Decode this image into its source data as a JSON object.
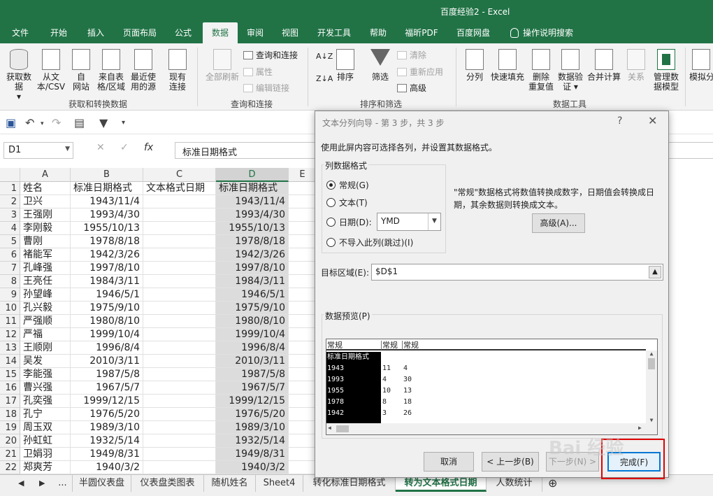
{
  "window": {
    "title": "百度经验2  -  Excel"
  },
  "menu": {
    "tabs": [
      "文件",
      "开始",
      "插入",
      "页面布局",
      "公式",
      "数据",
      "审阅",
      "视图",
      "开发工具",
      "帮助",
      "福昕PDF",
      "百度网盘",
      "操作说明搜索"
    ],
    "active": "数据"
  },
  "ribbon": {
    "get_data": "获取数据",
    "from_text_l1": "从文",
    "from_text_l2": "本/CSV",
    "from_web_l1": "自",
    "from_web_l2": "网站",
    "from_table_l1": "来自表",
    "from_table_l2": "格/区域",
    "recent_l1": "最近使",
    "recent_l2": "用的源",
    "existing_l1": "现有",
    "existing_l2": "连接",
    "group1": "获取和转换数据",
    "refresh_all": "全部刷新",
    "queries": "查询和连接",
    "properties": "属性",
    "edit_links": "编辑链接",
    "group2": "查询和连接",
    "sort": "排序",
    "filter": "筛选",
    "clear": "清除",
    "reapply": "重新应用",
    "advanced": "高级",
    "group3": "排序和筛选",
    "split": "分列",
    "flash_fill": "快速填充",
    "remove_dup_l1": "删除",
    "remove_dup_l2": "重复值",
    "validate_l1": "数据验",
    "validate_l2": "证",
    "consolidate": "合并计算",
    "relations": "关系",
    "model_l1": "管理数",
    "model_l2": "据模型",
    "group4": "数据工具",
    "whatif": "模拟分"
  },
  "formula_bar": {
    "name_box": "D1",
    "fx": "fx",
    "value": "标准日期格式"
  },
  "columns": [
    "A",
    "B",
    "C",
    "D",
    "E"
  ],
  "rows": [
    [
      "姓名",
      "标准日期格式",
      "文本格式日期",
      "标准日期格式"
    ],
    [
      "卫兴",
      "1943/11/4",
      "",
      "1943/11/4"
    ],
    [
      "王强刚",
      "1993/4/30",
      "",
      "1993/4/30"
    ],
    [
      "李刚毅",
      "1955/10/13",
      "",
      "1955/10/13"
    ],
    [
      "曹刚",
      "1978/8/18",
      "",
      "1978/8/18"
    ],
    [
      "褚能军",
      "1942/3/26",
      "",
      "1942/3/26"
    ],
    [
      "孔峰强",
      "1997/8/10",
      "",
      "1997/8/10"
    ],
    [
      "王亮任",
      "1984/3/11",
      "",
      "1984/3/11"
    ],
    [
      "孙望峰",
      "1946/5/1",
      "",
      "1946/5/1"
    ],
    [
      "孔兴毅",
      "1975/9/10",
      "",
      "1975/9/10"
    ],
    [
      "严强顺",
      "1980/8/10",
      "",
      "1980/8/10"
    ],
    [
      "严福",
      "1999/10/4",
      "",
      "1999/10/4"
    ],
    [
      "王顺刚",
      "1996/8/4",
      "",
      "1996/8/4"
    ],
    [
      "吴发",
      "2010/3/11",
      "",
      "2010/3/11"
    ],
    [
      "李能强",
      "1987/5/8",
      "",
      "1987/5/8"
    ],
    [
      "曹兴强",
      "1967/5/7",
      "",
      "1967/5/7"
    ],
    [
      "孔奕强",
      "1999/12/15",
      "",
      "1999/12/15"
    ],
    [
      "孔宁",
      "1976/5/20",
      "",
      "1976/5/20"
    ],
    [
      "周玉双",
      "1989/3/10",
      "",
      "1989/3/10"
    ],
    [
      "孙虹虹",
      "1932/5/14",
      "",
      "1932/5/14"
    ],
    [
      "卫娟羽",
      "1949/8/31",
      "",
      "1949/8/31"
    ],
    [
      "郑爽芳",
      "1940/3/2",
      "",
      "1940/3/2"
    ]
  ],
  "sheets": [
    "...",
    "半圆仪表盘",
    "仪表盘类图表",
    "随机姓名",
    "Sheet4",
    "转化标准日期格式",
    "转为文本格式日期",
    "人数统计"
  ],
  "active_sheet": "转为文本格式日期",
  "dialog": {
    "title": "文本分列向导 - 第 3 步，共 3 步",
    "help": "?",
    "close": "✕",
    "instruction": "使用此屏内容可选择各列，并设置其数据格式。",
    "legend": "列数据格式",
    "opt_general": "常规(G)",
    "opt_text": "文本(T)",
    "opt_date": "日期(D):",
    "date_format": "YMD",
    "opt_skip": "不导入此列(跳过)(I)",
    "description": "\"常规\"数据格式将数值转换成数字，日期值会转换成日期，其余数据则转换成文本。",
    "advanced_btn": "高级(A)...",
    "target_label": "目标区域(E):",
    "target_value": "$D$1",
    "preview_label": "数据预览(P)",
    "preview_headers": [
      "常规",
      "常规",
      "常规"
    ],
    "preview_rows": [
      [
        "标准日期格式",
        "",
        ""
      ],
      [
        "1943",
        "11",
        "4"
      ],
      [
        "1993",
        "4",
        "30"
      ],
      [
        "1955",
        "10",
        "13"
      ],
      [
        "1978",
        "8",
        "18"
      ],
      [
        "1942",
        "3",
        "26"
      ]
    ],
    "cancel": "取消",
    "back": "< 上一步(B)",
    "next": "下一步(N) >",
    "finish": "完成(F)"
  },
  "watermark": "Bai 经验"
}
